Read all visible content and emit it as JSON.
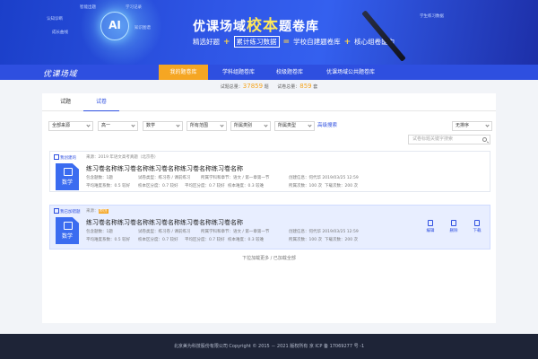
{
  "banner": {
    "ai_label": "AI",
    "floating_labels": [
      "认知诊断",
      "智能出题",
      "学习记录",
      "成长曲线",
      "知识图谱",
      "学生练习数据"
    ],
    "headline_part1": "优课场域",
    "headline_part2": "校本",
    "headline_part3": "题卷库",
    "slogan": [
      "精选好题",
      "+",
      "累计练习数据",
      "=",
      "学校自建题卷库",
      "+",
      "核心组卷能力"
    ]
  },
  "nav": {
    "logo": "优课场域",
    "items": [
      "我的题卷库",
      "学科组题卷库",
      "校级题卷库",
      "优课场域公共题卷库"
    ],
    "active_index": 0
  },
  "stats": {
    "questions_label": "试题总量：",
    "questions_count": "37859",
    "questions_unit": "题",
    "papers_label": "试卷总量：",
    "papers_count": "859",
    "papers_unit": "套"
  },
  "tabs": [
    "试题",
    "试卷"
  ],
  "active_tab": 1,
  "filters": [
    "全部来源",
    "高一",
    "数学",
    "所有范围",
    "所属类别",
    "所属类型"
  ],
  "advanced_search": "高级搜索",
  "sort": "无排序",
  "search_placeholder": "试卷标题关键字搜索",
  "cards": [
    {
      "tag": "我创建的",
      "source": "来源：2019 年语文高考真题（北京卷）",
      "source_highlight": "",
      "subject": "数学",
      "title": "练习卷名称练习卷名称练习卷名称练习卷名称练习卷名称",
      "meta_row1": [
        "包含题数：1题",
        "试卷类型：练习卷 / 课前练习",
        "所属学科和章节：语文 / 第一章第一节",
        "创建信息：何代华 2019/03/25 12:59"
      ],
      "meta_row2": [
        "平均难度系数：0.5 较好",
        "校本区分度：0.7 较好",
        "平均区分度：0.7 较好",
        "校本难度：0.3 较难",
        "所属次数：100 次",
        "下载次数：200 次"
      ]
    },
    {
      "tag": "我已加错题",
      "source": "来源：",
      "source_highlight": "原创",
      "subject": "数学",
      "title": "练习卷名称练习卷名称练习卷名称练习卷名称练习卷名称",
      "meta_row1": [
        "包含题数：1题",
        "试卷类型：练习卷 / 课前练习",
        "所属学科和章节：语文 / 第一章第一节",
        "创建信息：何代华 2019/03/25 12:59"
      ],
      "meta_row2": [
        "平均难度系数：0.5 较好",
        "校本区分度：0.7 较好",
        "平均区分度：0.7 较好",
        "校本难度：0.3 较难",
        "所属次数：100 次",
        "下载次数：200 次"
      ],
      "actions": [
        "编辑",
        "删除",
        "下载"
      ]
    }
  ],
  "load_more": "下拉加载更多 / 已加载全部",
  "footer": "北京美为科技股份有限公司    Copyright © 2015 － 2021 版权所有  京 ICP 备 17069277 号 -1"
}
